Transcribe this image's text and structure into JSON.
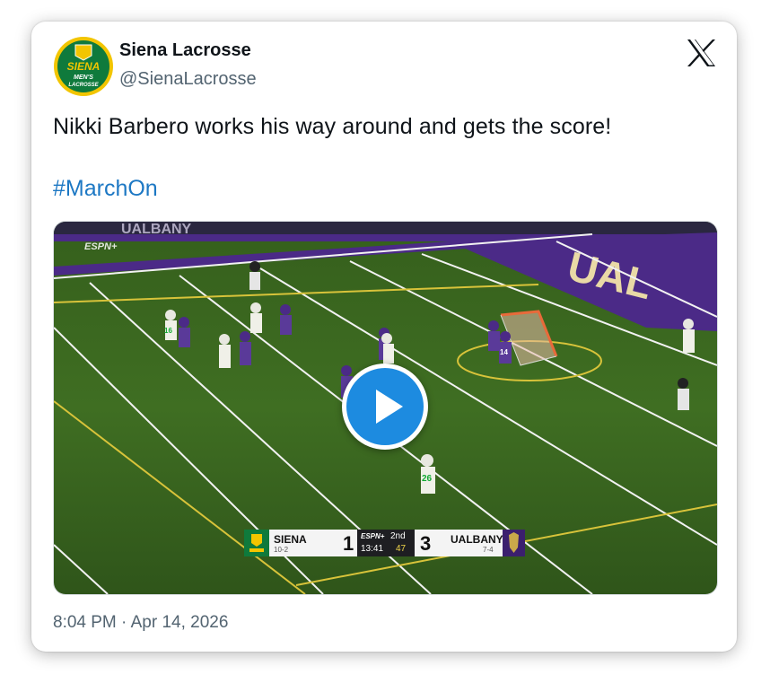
{
  "author": {
    "name": "Siena Lacrosse",
    "handle": "@SienaLacrosse",
    "avatar_text_line1": "SIENA",
    "avatar_text_line2": "MEN'S",
    "avatar_text_line3": "LACROSSE"
  },
  "post": {
    "text": "Nikki Barbero works his way around and gets the score!",
    "hashtag": "#MarchOn",
    "timestamp": "8:04 PM · Apr 14, 2026"
  },
  "media": {
    "type": "video",
    "play_icon": "play-icon",
    "broadcaster": "ESPN+",
    "wall_text": "UALBANY",
    "endzone_text": "UAL",
    "jersey_numbers": [
      "16",
      "26",
      "14"
    ],
    "scoreboard": {
      "home": {
        "name": "SIENA",
        "record": "10-2",
        "score": "1"
      },
      "away": {
        "name": "UALBANY",
        "record": "7-4",
        "score": "3"
      },
      "network": "ESPN+",
      "period": "2nd",
      "clock": "13:41",
      "shot_clock": "47"
    }
  },
  "colors": {
    "link": "#1d78c4",
    "play_button": "#1d8be0",
    "siena_green": "#0f7a3c",
    "siena_gold": "#f2c500",
    "ualbany_purple": "#4b2a87",
    "turf": "#3f6e22"
  },
  "icons": {
    "platform": "x-logo-icon"
  }
}
